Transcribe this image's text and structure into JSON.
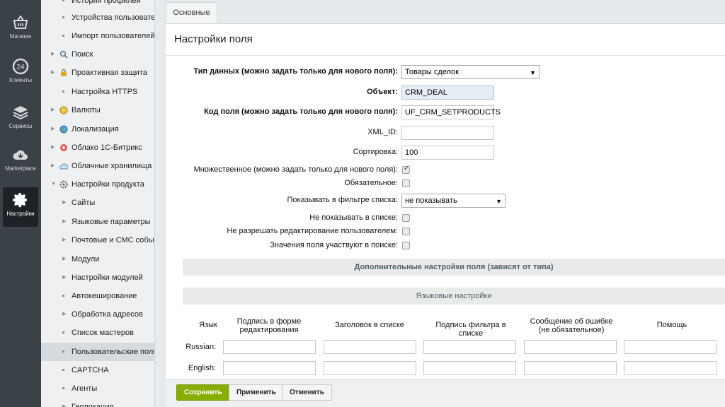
{
  "left_panel": [
    {
      "label": "Магазин",
      "icon": "basket-icon"
    },
    {
      "label": "Клиенты",
      "icon": "clients-24-icon"
    },
    {
      "label": "Сервисы",
      "icon": "layers-icon"
    },
    {
      "label": "Marketplace",
      "icon": "cloud-download-icon"
    },
    {
      "label": "Настройки",
      "icon": "gear-icon"
    }
  ],
  "tree": [
    {
      "label": "История профилей"
    },
    {
      "label": "Устройства пользователей"
    },
    {
      "label": "Импорт пользователей"
    },
    {
      "label": "Поиск"
    },
    {
      "label": "Проактивная защита"
    },
    {
      "label": "Настройка HTTPS"
    },
    {
      "label": "Валюты"
    },
    {
      "label": "Локализация"
    },
    {
      "label": "Облако 1С-Битрикс"
    },
    {
      "label": "Облачные хранилища"
    },
    {
      "label": "Настройки продукта"
    },
    {
      "label": "Сайты"
    },
    {
      "label": "Языковые параметры"
    },
    {
      "label": "Почтовые и СМС события"
    },
    {
      "label": "Модули"
    },
    {
      "label": "Настройки модулей"
    },
    {
      "label": "Автокеширование"
    },
    {
      "label": "Обработка адресов"
    },
    {
      "label": "Список мастеров"
    },
    {
      "label": "Пользовательские поля"
    },
    {
      "label": "CAPTCHA"
    },
    {
      "label": "Агенты"
    },
    {
      "label": "Геолокация"
    }
  ],
  "tab": "Основные",
  "title": "Настройки поля",
  "fields": {
    "data_type": {
      "label": "Тип данных (можно задать только для нового поля):",
      "value": "Товары сделок"
    },
    "object": {
      "label": "Объект:",
      "value": "CRM_DEAL"
    },
    "code": {
      "label": "Код поля (можно задать только для нового поля):",
      "value": "UF_CRM_SETPRODUCTS"
    },
    "xml_id": {
      "label": "XML_ID:",
      "value": ""
    },
    "sort": {
      "label": "Сортировка:",
      "value": "100"
    },
    "multiple": {
      "label": "Множественное (можно задать только для нового поля):"
    },
    "required": {
      "label": "Обязательное:"
    },
    "show_filter": {
      "label": "Показывать в фильтре списка:",
      "value": "не показывать"
    },
    "hide_list": {
      "label": "Не показывать в списке:"
    },
    "no_edit": {
      "label": "Не разрешать редактирование пользователем:"
    },
    "search": {
      "label": "Значения поля участвуют в поиске:"
    }
  },
  "sections": {
    "extra": "Дополнительные настройки поля (зависят от типа)",
    "lang": "Языковые настройки"
  },
  "lang_table": {
    "headers": [
      "Язык",
      "Подпись в форме редактирования",
      "Заголовок в списке",
      "Подпись фильтра в списке",
      "Сообщение об ошибке (не обязательное)",
      "Помощь"
    ],
    "rows": [
      "Russian:",
      "English:"
    ]
  },
  "buttons": {
    "save": "Сохранить",
    "apply": "Применить",
    "cancel": "Отменить"
  }
}
